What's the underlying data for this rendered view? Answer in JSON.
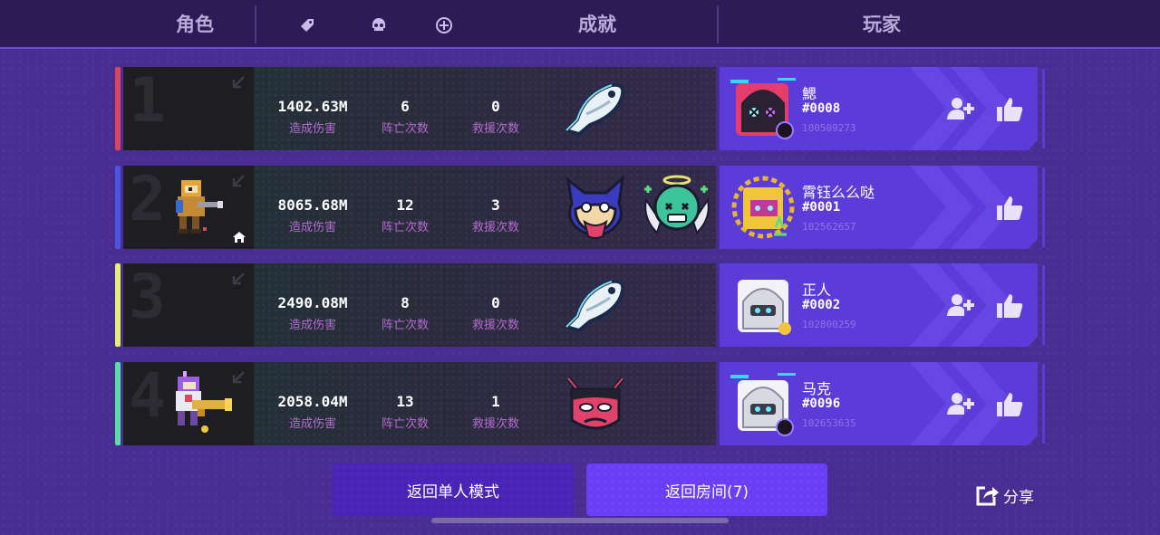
{
  "header": {
    "col_role": "角色",
    "col_achievement": "成就",
    "col_player": "玩家",
    "icons": [
      "tag-icon",
      "skull-icon",
      "plus-circle-icon"
    ]
  },
  "rows": [
    {
      "rank": "1",
      "accent": "#e0425a",
      "has_character": false,
      "has_home": false,
      "damage": "1402.63M",
      "damage_label": "造成伤害",
      "deaths": "6",
      "deaths_label": "阵亡次数",
      "rescues": "0",
      "rescues_label": "救援次数",
      "achievements": [
        "fish-badge-icon"
      ],
      "player": {
        "name": "鰓",
        "tag": "#0008",
        "id": "100509273",
        "avatar": "hooded-pink-avatar",
        "can_add_friend": true
      }
    },
    {
      "rank": "2",
      "accent": "#4a55e6",
      "has_character": true,
      "has_home": true,
      "damage": "8065.68M",
      "damage_label": "造成伤害",
      "deaths": "12",
      "deaths_label": "阵亡次数",
      "rescues": "3",
      "rescues_label": "救援次数",
      "achievements": [
        "wolf-badge-icon",
        "angel-ghost-badge-icon"
      ],
      "player": {
        "name": "霄钰么么哒",
        "tag": "#0001",
        "id": "102562657",
        "avatar": "gold-hood-avatar",
        "can_add_friend": false
      }
    },
    {
      "rank": "3",
      "accent": "#e7f06a",
      "has_character": false,
      "has_home": false,
      "damage": "2490.08M",
      "damage_label": "造成伤害",
      "deaths": "8",
      "deaths_label": "阵亡次数",
      "rescues": "0",
      "rescues_label": "救援次数",
      "achievements": [
        "fish-badge-icon"
      ],
      "player": {
        "name": "正人",
        "tag": "#0002",
        "id": "102800259",
        "avatar": "white-hood-avatar",
        "can_add_friend": true
      }
    },
    {
      "rank": "4",
      "accent": "#56e0a6",
      "has_character": true,
      "has_home": false,
      "damage": "2058.04M",
      "damage_label": "造成伤害",
      "deaths": "13",
      "deaths_label": "阵亡次数",
      "rescues": "1",
      "rescues_label": "救援次数",
      "achievements": [
        "red-demon-badge-icon"
      ],
      "player": {
        "name": "马克",
        "tag": "#0096",
        "id": "102653635",
        "avatar": "white-hood-avatar",
        "can_add_friend": true
      }
    }
  ],
  "buttons": {
    "back_single": "返回单人模式",
    "back_room": "返回房间(7)",
    "share": "分享"
  }
}
